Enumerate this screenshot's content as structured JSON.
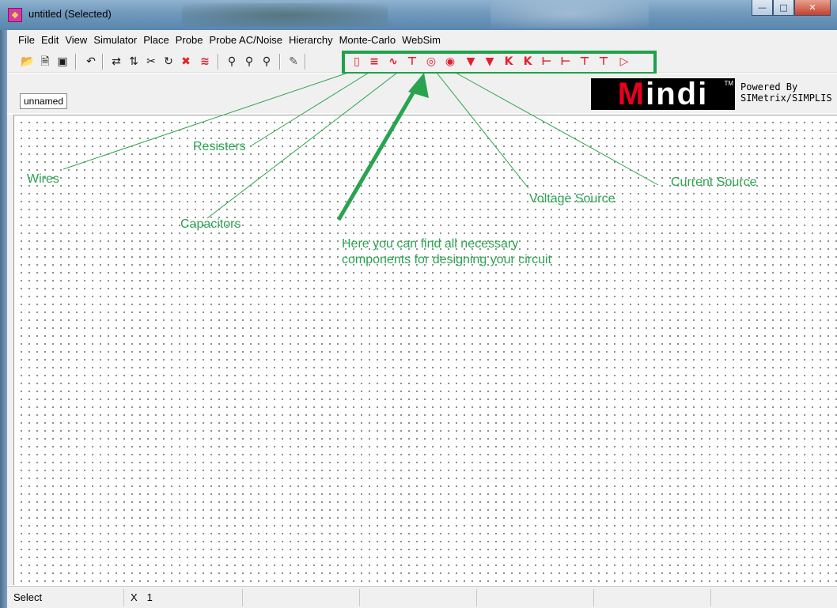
{
  "window": {
    "title": "untitled (Selected)",
    "controls": {
      "minimize_icon": "minimize-icon",
      "maximize_icon": "maximize-icon",
      "close_icon": "close-icon"
    }
  },
  "menu": [
    "File",
    "Edit",
    "View",
    "Simulator",
    "Place",
    "Probe",
    "Probe AC/Noise",
    "Hierarchy",
    "Monte-Carlo",
    "WebSim"
  ],
  "toolbar": {
    "general_icons": [
      "open-icon",
      "new-icon",
      "save-icon",
      "undo-icon",
      "mirror-icon",
      "flip-icon",
      "cut-icon",
      "rotate-icon",
      "delete-icon",
      "delete-wires-icon",
      "zoom-fit-icon",
      "zoom-out-icon",
      "zoom-in-icon",
      "pencil-icon"
    ],
    "component_icons": [
      "wire-icon",
      "resistor-icon",
      "inductor-icon",
      "capacitor-icon",
      "voltage-source-icon",
      "current-source-icon",
      "diode-icon",
      "zener-diode-icon",
      "npn-icon",
      "pnp-icon",
      "nmos-icon",
      "pmos-icon",
      "ground-icon",
      "ground-alt-icon",
      "opamp-icon"
    ],
    "highlight_color": "#1fa24a"
  },
  "document_tab": "unnamed",
  "branding": {
    "logo_text": "Mindi",
    "trademark": "TM",
    "powered_line1": "Powered By",
    "powered_line2": "SIMetrix/SIMPLIS",
    "logo_accent": "#e8001c"
  },
  "annotations": {
    "color": "#2aa34f",
    "wires": "Wires",
    "resisters": "Resisters",
    "capacitors": "Capacitors",
    "voltage_source": "Voltage Source",
    "current_source": "Current Source",
    "hint_line1": "Here you can find all  necessary",
    "hint_line2": "components for designing your circuit"
  },
  "status": {
    "mode": "Select",
    "x_label": "X",
    "x_value": "1"
  }
}
